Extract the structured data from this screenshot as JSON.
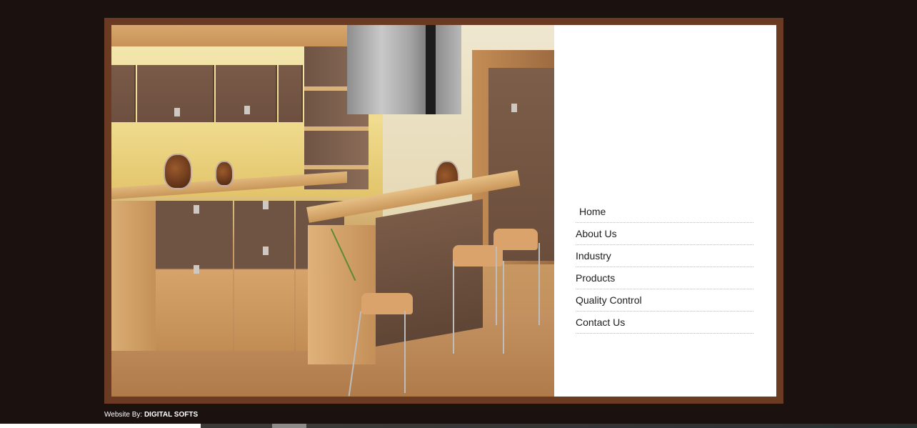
{
  "nav": {
    "items": [
      {
        "label": "Home"
      },
      {
        "label": "About Us"
      },
      {
        "label": "Industry"
      },
      {
        "label": "Products"
      },
      {
        "label": "Quality Control"
      },
      {
        "label": "Contact Us"
      }
    ]
  },
  "footer": {
    "credit_prefix": "Website By:",
    "credit_name": "DIGITAL SOFTS"
  },
  "colors": {
    "page_background": "#1b1210",
    "frame_border": "#6b3a22",
    "menu_text": "#1d1d1d"
  }
}
